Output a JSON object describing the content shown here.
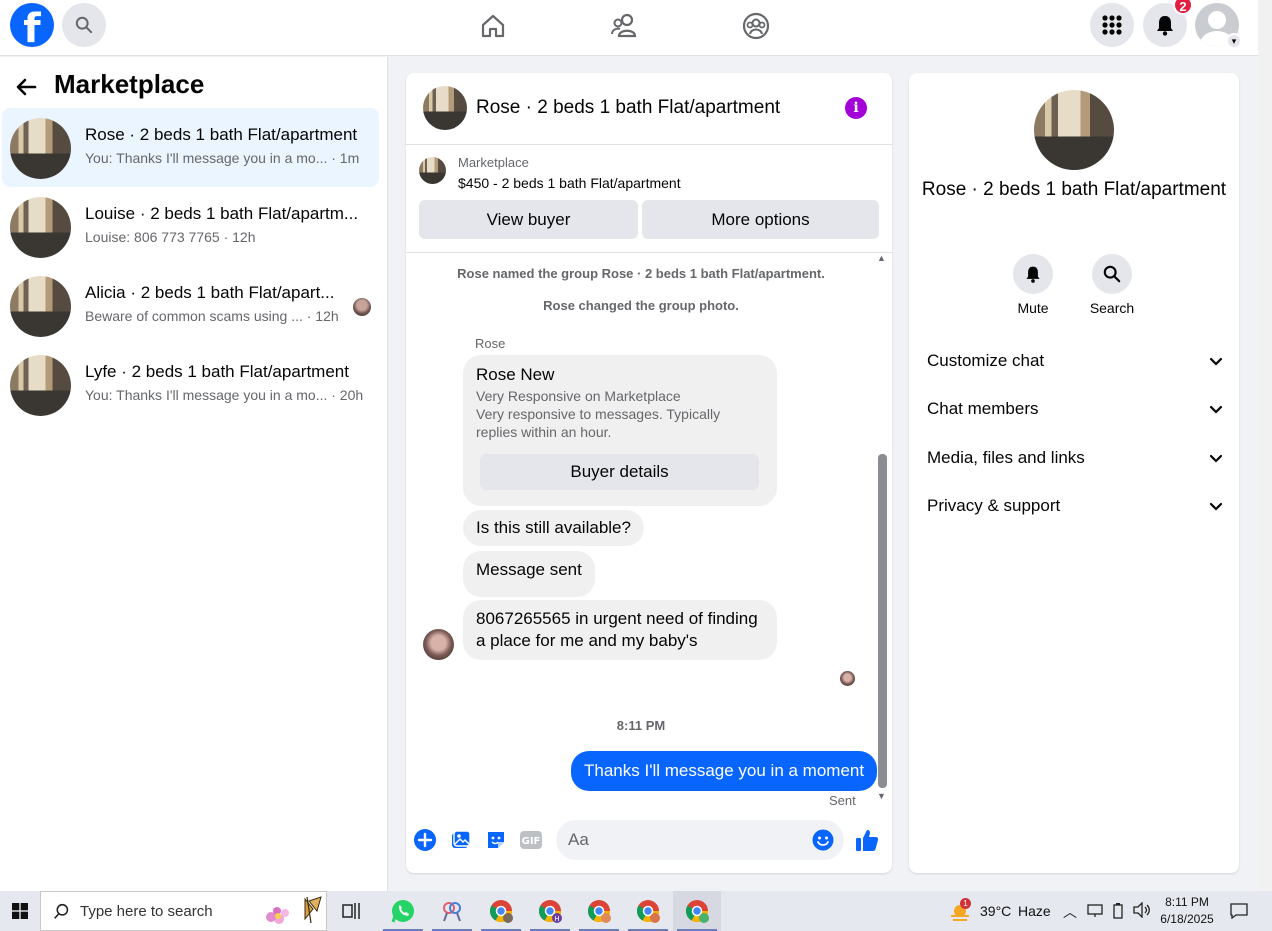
{
  "topbar": {
    "logo": "f",
    "notification_count": "2",
    "icons": [
      "facebook-logo",
      "search-icon",
      "home-icon",
      "friends-icon",
      "groups-icon",
      "menu-grid-icon",
      "bell-icon",
      "avatar"
    ]
  },
  "sidebar": {
    "title": "Marketplace",
    "conversations": [
      {
        "name": "Rose · 2 beds 1 bath Flat/apartment",
        "preview": "You: Thanks I'll message you in a mo... · 1m"
      },
      {
        "name": "Louise · 2 beds 1 bath Flat/apartm...",
        "preview": "Louise: 806 773 7765 · 12h"
      },
      {
        "name": "Alicia · 2 beds 1 bath Flat/apart...",
        "preview": "Beware of common scams using ... · 12h"
      },
      {
        "name": "Lyfe · 2 beds 1 bath Flat/apartment",
        "preview": "You: Thanks I'll message you in a mo... · 20h"
      }
    ]
  },
  "chat": {
    "title": "Rose · 2 beds 1 bath Flat/apartment",
    "listing": {
      "source": "Marketplace",
      "price_title": "$450 - 2 beds 1 bath Flat/apartment",
      "view_buyer": "View buyer",
      "more_options": "More options"
    },
    "system_messages": [
      "Rose named the group Rose · 2 beds 1 bath Flat/apartment.",
      "Rose changed the group photo."
    ],
    "sender": "Rose",
    "card": {
      "name": "Rose New",
      "line1": "Very Responsive on Marketplace",
      "line2": "Very responsive to messages. Typically",
      "line3": "replies within an hour.",
      "button": "Buyer details"
    },
    "messages": [
      {
        "text": "Is this still available?"
      },
      {
        "text": "Message sent"
      },
      {
        "text": "8067265565 in urgent need of finding a place for me and my baby's"
      }
    ],
    "time": "8:11 PM",
    "my_message": "Thanks I'll message you in a moment",
    "status": "Sent",
    "composer_placeholder": "Aa"
  },
  "info_panel": {
    "name": "Rose · 2 beds 1 bath Flat/apartment",
    "mute": "Mute",
    "search": "Search",
    "sections": [
      "Customize chat",
      "Chat members",
      "Media, files and links",
      "Privacy & support"
    ]
  },
  "taskbar": {
    "search_placeholder": "Type here to search",
    "temperature": "39°C",
    "weather": "Haze",
    "time": "8:11 PM",
    "date": "6/18/2025",
    "weather_alert_count": "1"
  },
  "colors": {
    "brand": "#0866ff",
    "active_conv": "#ebf5ff",
    "info_icon": "#a400d8",
    "badge": "#e41e3f"
  }
}
